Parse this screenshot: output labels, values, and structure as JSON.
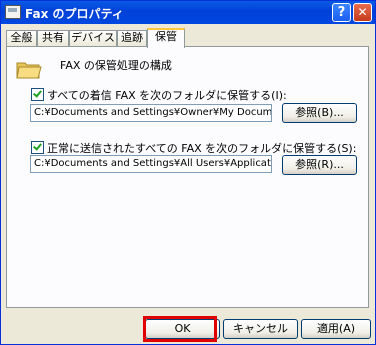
{
  "window": {
    "title": "Fax のプロパティ"
  },
  "title_buttons": {
    "help": "?",
    "close": "✕"
  },
  "tabs": [
    {
      "label": "全般",
      "active": false
    },
    {
      "label": "共有",
      "active": false
    },
    {
      "label": "デバイス",
      "active": false
    },
    {
      "label": "追跡",
      "active": false
    },
    {
      "label": "保管",
      "active": true
    }
  ],
  "archive": {
    "section_title": "FAX の保管処理の構成",
    "incoming_checkbox_label": "すべての着信 FAX を次のフォルダに保管する(I):",
    "incoming_checked": true,
    "incoming_path": "C:¥Documents and Settings¥Owner¥My Documents",
    "incoming_browse": "参照(B)...",
    "sent_checkbox_label": "正常に送信されたすべての FAX を次のフォルダに保管する(S):",
    "sent_checked": true,
    "sent_path": "C:¥Documents and Settings¥All Users¥Application Data¥",
    "sent_browse": "参照(R)..."
  },
  "footer": {
    "ok": "OK",
    "cancel": "キャンセル",
    "apply": "適用(A)"
  },
  "colors": {
    "title_bar": "#0a5ae6",
    "highlight": "#e00000",
    "tab_active_accent": "#ffc83c"
  }
}
